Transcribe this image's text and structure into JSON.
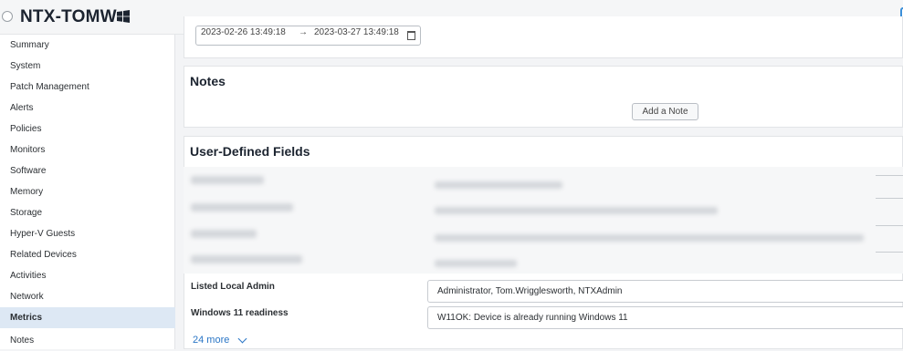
{
  "header": {
    "device_name": "NTX-TOMW",
    "zoom_label": "Zo"
  },
  "sidebar": {
    "items": [
      {
        "label": "Summary"
      },
      {
        "label": "System"
      },
      {
        "label": "Patch Management"
      },
      {
        "label": "Alerts"
      },
      {
        "label": "Policies"
      },
      {
        "label": "Monitors"
      },
      {
        "label": "Software"
      },
      {
        "label": "Memory"
      },
      {
        "label": "Storage"
      },
      {
        "label": "Hyper-V Guests"
      },
      {
        "label": "Related Devices"
      },
      {
        "label": "Activities"
      },
      {
        "label": "Network"
      },
      {
        "label": "Metrics",
        "active": true
      },
      {
        "label": "Notes"
      }
    ]
  },
  "date_range": {
    "start": "2023-02-26 13:49:18",
    "arrow": "→",
    "end": "2023-03-27 13:49:18"
  },
  "notes": {
    "title": "Notes",
    "add_button": "Add a Note"
  },
  "udf": {
    "title": "User-Defined Fields",
    "fields": [
      {
        "label": "Listed Local Admin",
        "value": "Administrator, Tom.Wrigglesworth, NTXAdmin"
      },
      {
        "label": "Windows 11 readiness",
        "value": "W11OK: Device is already running Windows 11"
      }
    ],
    "more_link": "24 more"
  },
  "colors": {
    "accent": "#2a76c6",
    "active_nav": "#dde8f4"
  }
}
